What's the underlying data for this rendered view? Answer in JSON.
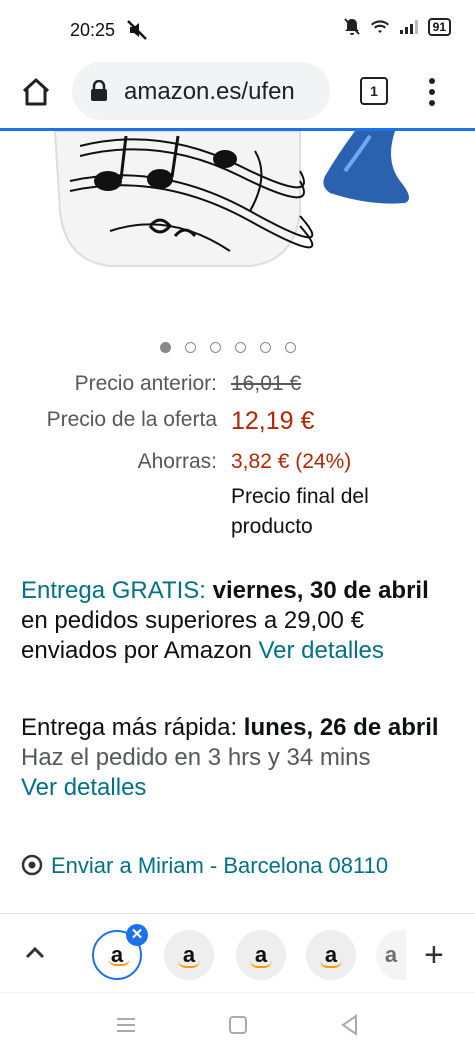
{
  "status": {
    "time": "20:25",
    "battery": "91"
  },
  "browser": {
    "url": "amazon.es/ufen",
    "tab_count": "1"
  },
  "gallery": {
    "total_images": 6,
    "active_index": 0
  },
  "pricing": {
    "old_label": "Precio anterior:",
    "old_value": "16,01 €",
    "deal_label": "Precio de la oferta",
    "deal_value": "12,19 €",
    "save_label": "Ahorras:",
    "save_value": "3,82 € (24%)",
    "final_note": "Precio final del producto"
  },
  "delivery": {
    "free_label": "Entrega GRATIS:",
    "free_date": "viernes, 30 de abril",
    "free_text": "en pedidos superiores a 29,00 € enviados por Amazon",
    "free_link": "Ver detalles",
    "fast_label": "Entrega más rápida:",
    "fast_date": "lunes, 26 de abril",
    "fast_order": "Haz el pedido en 3 hrs y 34 mins",
    "fast_link": "Ver detalles"
  },
  "ship_to": "Enviar a Miriam - Barcelona 08110",
  "tabs": [
    {
      "label": "a",
      "active": true
    },
    {
      "label": "a"
    },
    {
      "label": "a"
    },
    {
      "label": "a"
    },
    {
      "label": "a"
    }
  ],
  "colors": {
    "teal": "#007185",
    "price_red": "#b12704",
    "chrome_blue": "#1a73e8"
  }
}
